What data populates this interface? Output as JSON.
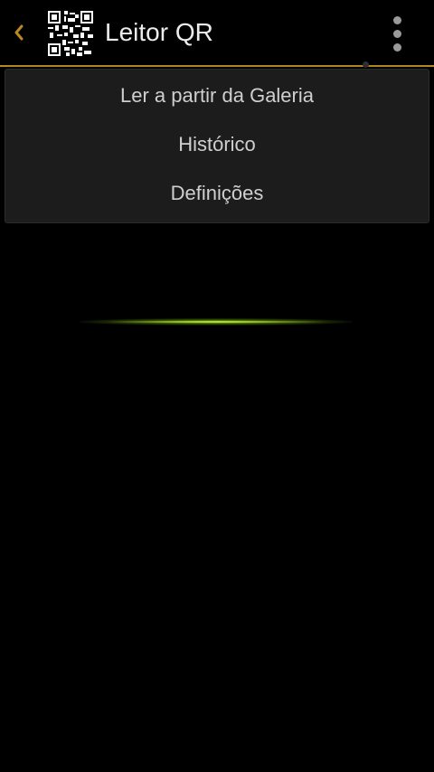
{
  "colors": {
    "accent": "#b98a22",
    "background": "#000000",
    "menu_background": "#1c1c1c",
    "menu_text": "#cfcfcf",
    "title_text": "#ececec",
    "scan_line": "#aadc28"
  },
  "action_bar": {
    "title": "Leitor QR",
    "back_icon": "chevron-left-icon",
    "app_icon": "qr-code-icon",
    "overflow_icon": "more-vertical-icon"
  },
  "popup_menu": {
    "items": [
      {
        "label": "Ler a partir da Galeria"
      },
      {
        "label": "Histórico"
      },
      {
        "label": "Definições"
      }
    ]
  },
  "scanner": {
    "line_icon": "scan-line"
  }
}
